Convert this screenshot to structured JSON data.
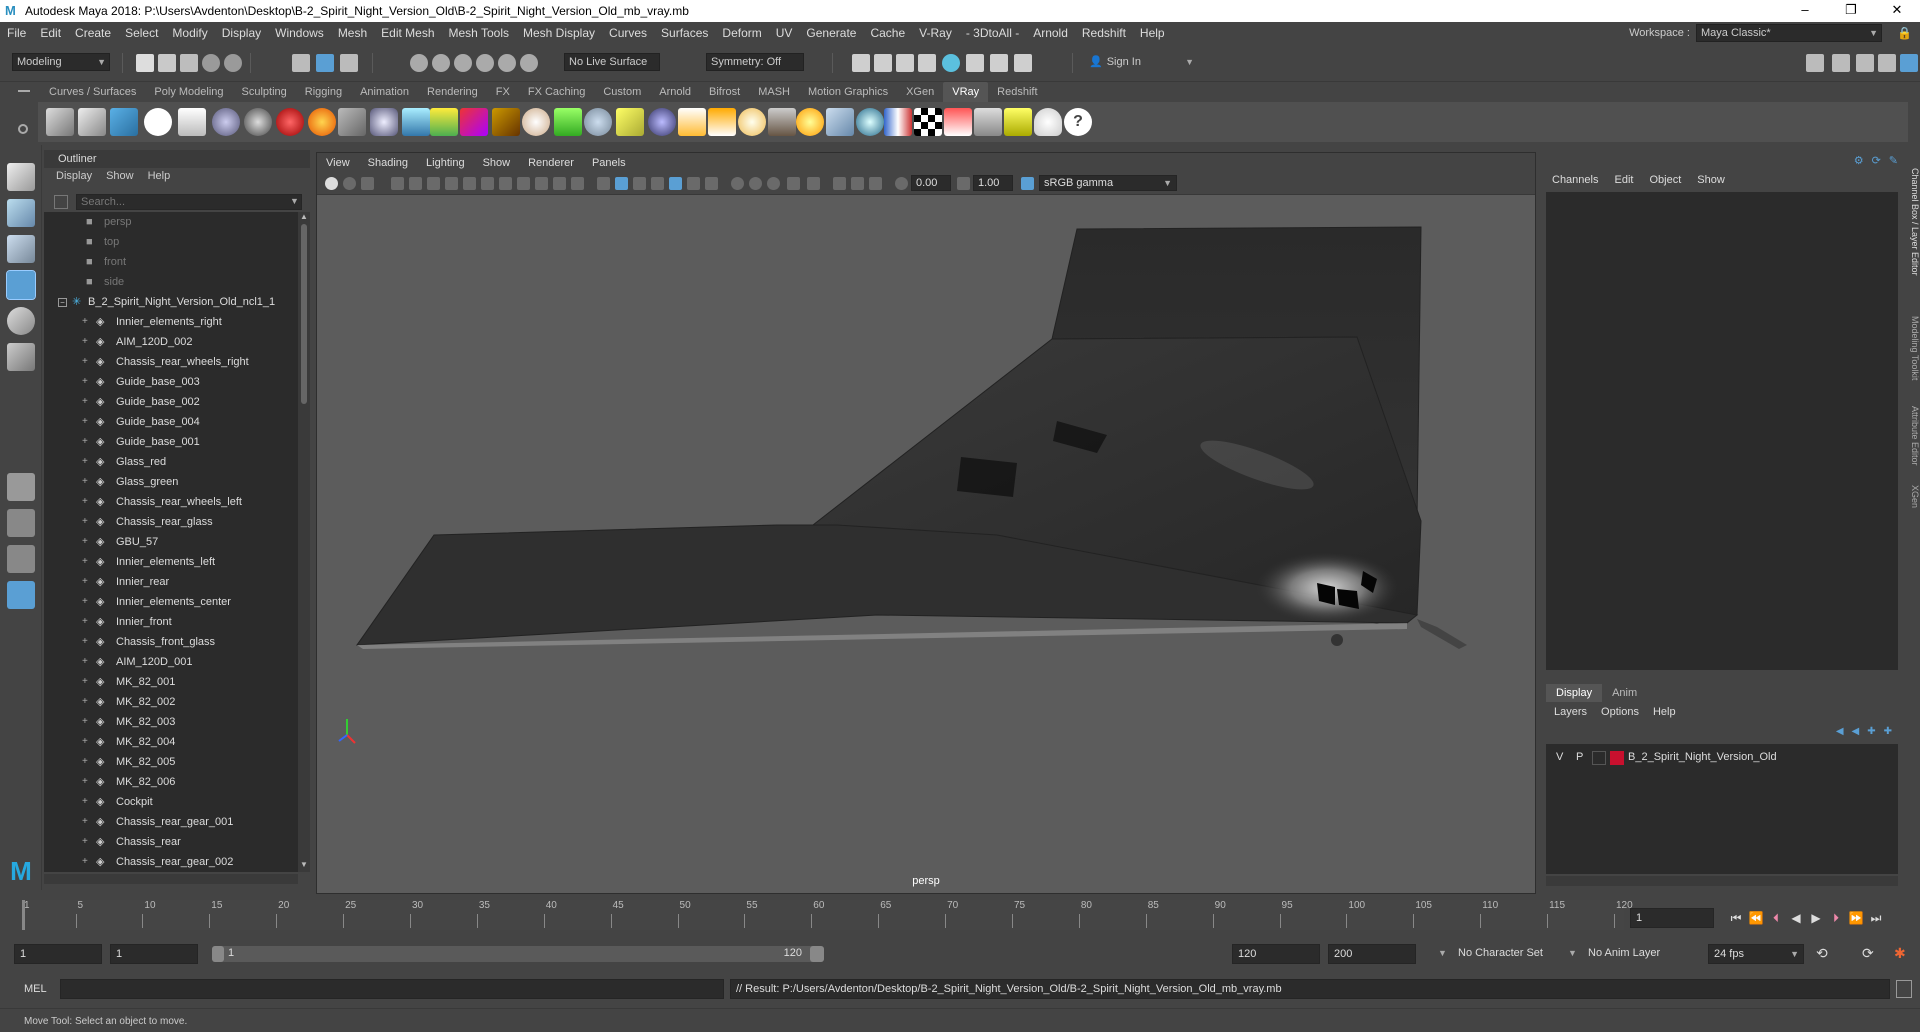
{
  "window": {
    "title": "Autodesk Maya 2018: P:\\Users\\Avdenton\\Desktop\\B-2_Spirit_Night_Version_Old\\B-2_Spirit_Night_Version_Old_mb_vray.mb",
    "minimize": "–",
    "maximize": "❐",
    "close": "✕"
  },
  "menubar": {
    "items": [
      "File",
      "Edit",
      "Create",
      "Select",
      "Modify",
      "Display",
      "Windows",
      "Mesh",
      "Edit Mesh",
      "Mesh Tools",
      "Mesh Display",
      "Curves",
      "Surfaces",
      "Deform",
      "UV",
      "Generate",
      "Cache",
      "V-Ray",
      "- 3DtoAll -",
      "Arnold",
      "Redshift",
      "Help"
    ],
    "workspace_label": "Workspace :",
    "workspace_value": "Maya Classic*"
  },
  "statusline": {
    "mode": "Modeling",
    "live_surface": "No Live Surface",
    "symmetry": "Symmetry: Off",
    "sign_in": "Sign In"
  },
  "shelf": {
    "tabs": [
      "Curves / Surfaces",
      "Poly Modeling",
      "Sculpting",
      "Rigging",
      "Animation",
      "Rendering",
      "FX",
      "FX Caching",
      "Custom",
      "Arnold",
      "Bifrost",
      "MASH",
      "Motion Graphics",
      "XGen",
      "VRay",
      "Redshift"
    ],
    "active_tab": "VRay"
  },
  "outliner": {
    "title": "Outliner",
    "menu": [
      "Display",
      "Show",
      "Help"
    ],
    "search_placeholder": "Search...",
    "cameras": [
      "persp",
      "top",
      "front",
      "side"
    ],
    "root": "B_2_Spirit_Night_Version_Old_ncl1_1",
    "items": [
      "Innier_elements_right",
      "AIM_120D_002",
      "Chassis_rear_wheels_right",
      "Guide_base_003",
      "Guide_base_002",
      "Guide_base_004",
      "Guide_base_001",
      "Glass_red",
      "Glass_green",
      "Chassis_rear_wheels_left",
      "Chassis_rear_glass",
      "GBU_57",
      "Innier_elements_left",
      "Innier_rear",
      "Innier_elements_center",
      "Innier_front",
      "Chassis_front_glass",
      "AIM_120D_001",
      "MK_82_001",
      "MK_82_002",
      "MK_82_003",
      "MK_82_004",
      "MK_82_005",
      "MK_82_006",
      "Cockpit",
      "Chassis_rear_gear_001",
      "Chassis_rear",
      "Chassis_rear_gear_002"
    ]
  },
  "viewport": {
    "menu": [
      "View",
      "Shading",
      "Lighting",
      "Show",
      "Renderer",
      "Panels"
    ],
    "near_value": "0.00",
    "far_value": "1.00",
    "color_space": "sRGB gamma",
    "camera_label": "persp"
  },
  "channelbox": {
    "menu": [
      "Channels",
      "Edit",
      "Object",
      "Show"
    ],
    "side_tabs": [
      "Channel Box / Layer Editor",
      "Modeling Toolkit",
      "Attribute Editor",
      "XGen"
    ]
  },
  "layers": {
    "tabs": [
      "Display",
      "Anim"
    ],
    "active_tab": "Display",
    "menu": [
      "Layers",
      "Options",
      "Help"
    ],
    "row": {
      "v": "V",
      "p": "P",
      "name": "B_2_Spirit_Night_Version_Old",
      "color": "#c8102e"
    }
  },
  "timeline": {
    "ticks": [
      "1",
      "5",
      "10",
      "15",
      "20",
      "25",
      "30",
      "35",
      "40",
      "45",
      "50",
      "55",
      "60",
      "65",
      "70",
      "75",
      "80",
      "85",
      "90",
      "95",
      "100",
      "105",
      "110",
      "115",
      "120"
    ],
    "current_frame": "1"
  },
  "range": {
    "start": "1",
    "anim_start": "1",
    "range_start": "1",
    "range_end": "120",
    "end": "120",
    "anim_end": "200",
    "character_set": "No Character Set",
    "anim_layer": "No Anim Layer",
    "fps": "24 fps"
  },
  "cmdline": {
    "label": "MEL",
    "result": "// Result: P:/Users/Avdenton/Desktop/B-2_Spirit_Night_Version_Old/B-2_Spirit_Night_Version_Old_mb_vray.mb"
  },
  "helpline": {
    "text": "Move Tool: Select an object to move."
  },
  "colors": {
    "accent": "#5a9fd4",
    "panel": "#444444",
    "field": "#2b2b2b",
    "viewport_bg": "#5c5c5c"
  }
}
